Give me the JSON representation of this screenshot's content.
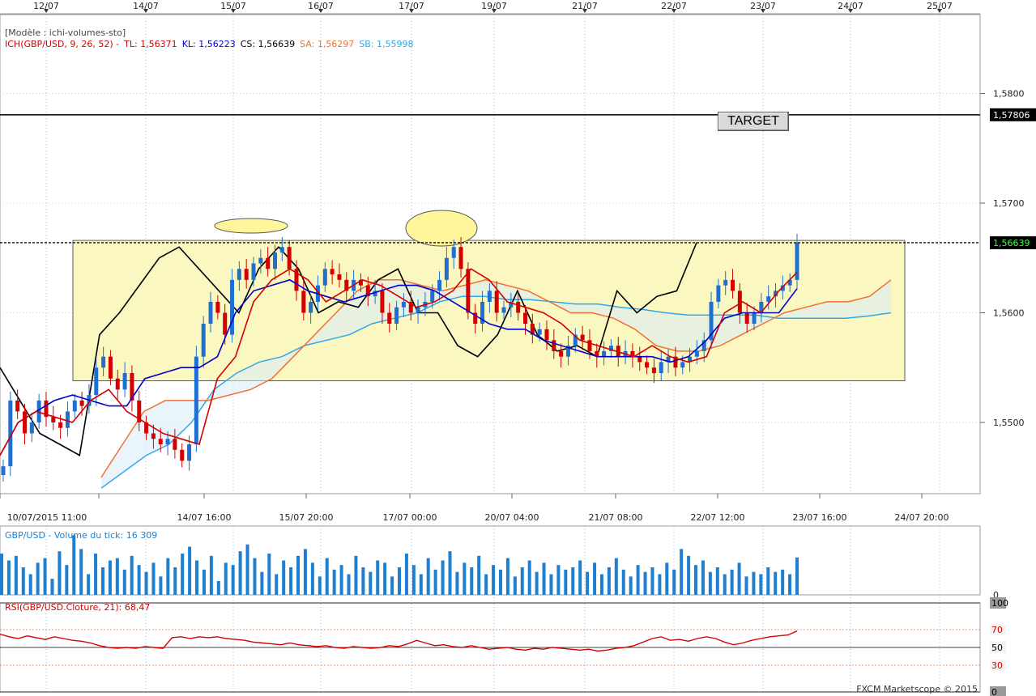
{
  "window": {
    "model_label": "[Modèle : ichi-volumes-sto]",
    "copyright": "FXCM Marketscope © 2015"
  },
  "ichimoku_legend": {
    "prefix": "ICH(GBP/USD, 9, 26, 52) -",
    "tl": "TL: 1,56371",
    "kl": "KL: 1,56223",
    "cs": "CS: 1,56639",
    "sa": "SA: 1,56297",
    "sb": "SB: 1,55998"
  },
  "volume_legend": "GBP/USD - Volume du tick: 16 309",
  "rsi_legend": "RSI(GBP/USD.Cloture, 21): 68,47",
  "annotations": {
    "target_label": "TARGET",
    "target_price": "1,57806",
    "current_price": "1,56639"
  },
  "colors": {
    "tl": "#d40000",
    "kl": "#0000c8",
    "cs": "#000000",
    "sa": "#f07030",
    "sb": "#30a8e8",
    "box_fill": "#fbf7c0",
    "volume": "#1e7fd0",
    "rsi": "#d40000"
  },
  "chart_data": [
    {
      "type": "candlestick",
      "top_date_ticks": [
        "12/07",
        "14/07",
        "15/07",
        "16/07",
        "17/07",
        "19/07",
        "21/07",
        "22/07",
        "23/07",
        "24/07",
        "25/07"
      ],
      "x_ticks": [
        "10/07/2015 11:00",
        "14/07 16:00",
        "15/07 20:00",
        "17/07 00:00",
        "20/07 04:00",
        "21/07 08:00",
        "22/07 12:00",
        "23/07 16:00",
        "24/07 20:00"
      ],
      "y_ticks": [
        "1,5800",
        "1,5700",
        "1,5600",
        "1,5500"
      ],
      "ylim": [
        1.5435,
        1.5872
      ],
      "target_level": 1.57806,
      "current_level": 1.56639,
      "range_box": {
        "low": 1.5538,
        "high": 1.5666
      },
      "closes": [
        1.546,
        1.552,
        1.551,
        1.549,
        1.55,
        1.552,
        1.5505,
        1.55,
        1.5495,
        1.551,
        1.552,
        1.5515,
        1.5525,
        1.555,
        1.556,
        1.554,
        1.553,
        1.5545,
        1.552,
        1.55,
        1.549,
        1.5485,
        1.548,
        1.5485,
        1.5475,
        1.5465,
        1.548,
        1.556,
        1.559,
        1.561,
        1.56,
        1.558,
        1.563,
        1.564,
        1.563,
        1.5645,
        1.565,
        1.564,
        1.5655,
        1.566,
        1.564,
        1.562,
        1.56,
        1.561,
        1.5625,
        1.564,
        1.5635,
        1.563,
        1.562,
        1.563,
        1.5625,
        1.5615,
        1.562,
        1.56,
        1.559,
        1.5605,
        1.561,
        1.56,
        1.5605,
        1.561,
        1.562,
        1.563,
        1.565,
        1.566,
        1.564,
        1.56,
        1.559,
        1.561,
        1.562,
        1.56,
        1.5605,
        1.561,
        1.56,
        1.559,
        1.558,
        1.5585,
        1.5575,
        1.5565,
        1.556,
        1.557,
        1.558,
        1.5575,
        1.5565,
        1.556,
        1.5565,
        1.557,
        1.556,
        1.5565,
        1.556,
        1.5555,
        1.555,
        1.5545,
        1.5555,
        1.556,
        1.555,
        1.5555,
        1.556,
        1.5565,
        1.5575,
        1.561,
        1.5625,
        1.563,
        1.562,
        1.56,
        1.559,
        1.56,
        1.561,
        1.5615,
        1.562,
        1.5625,
        1.563,
        1.5664
      ],
      "tenkan": [
        1.547,
        1.55,
        1.551,
        1.5505,
        1.55,
        1.552,
        1.553,
        1.551,
        1.55,
        1.549,
        1.5485,
        1.548,
        1.554,
        1.556,
        1.561,
        1.563,
        1.564,
        1.563,
        1.561,
        1.562,
        1.563,
        1.5625,
        1.5615,
        1.5605,
        1.561,
        1.562,
        1.564,
        1.563,
        1.561,
        1.5605,
        1.56,
        1.559,
        1.5575,
        1.557,
        1.5565,
        1.556,
        1.557,
        1.556,
        1.5555,
        1.556,
        1.56,
        1.561,
        1.56,
        1.562,
        1.5637
      ],
      "kijun": [
        1.547,
        1.55,
        1.551,
        1.552,
        1.5525,
        1.552,
        1.5515,
        1.5515,
        1.554,
        1.5545,
        1.555,
        1.555,
        1.556,
        1.56,
        1.562,
        1.5625,
        1.563,
        1.562,
        1.5615,
        1.561,
        1.5615,
        1.562,
        1.5625,
        1.5625,
        1.562,
        1.561,
        1.56,
        1.559,
        1.5585,
        1.5585,
        1.5575,
        1.557,
        1.5565,
        1.556,
        1.556,
        1.556,
        1.556,
        1.5555,
        1.556,
        1.5575,
        1.5595,
        1.56,
        1.56,
        1.56,
        1.5622
      ],
      "chikou": [
        1.555,
        1.552,
        1.549,
        1.548,
        1.547,
        1.558,
        1.56,
        1.5625,
        1.565,
        1.566,
        1.564,
        1.562,
        1.56,
        1.564,
        1.566,
        1.564,
        1.56,
        1.561,
        1.5605,
        1.563,
        1.564,
        1.56,
        1.56,
        1.557,
        1.556,
        1.558,
        1.562,
        1.558,
        1.5565,
        1.557,
        1.556,
        1.562,
        1.56,
        1.5615,
        1.562,
        1.5664
      ],
      "senkou_a": [
        1.545,
        1.548,
        1.551,
        1.552,
        1.552,
        1.552,
        1.5525,
        1.553,
        1.554,
        1.556,
        1.558,
        1.56,
        1.562,
        1.563,
        1.563,
        1.5625,
        1.562,
        1.5625,
        1.563,
        1.5625,
        1.562,
        1.561,
        1.56,
        1.56,
        1.5595,
        1.5585,
        1.557,
        1.5565,
        1.5565,
        1.557,
        1.558,
        1.559,
        1.56,
        1.5605,
        1.561,
        1.561,
        1.5615,
        1.563
      ],
      "senkou_b": [
        1.544,
        1.5455,
        1.547,
        1.548,
        1.55,
        1.553,
        1.5545,
        1.5555,
        1.556,
        1.557,
        1.5575,
        1.558,
        1.559,
        1.5595,
        1.56,
        1.561,
        1.5615,
        1.5615,
        1.5612,
        1.5612,
        1.561,
        1.5608,
        1.5608,
        1.5605,
        1.5603,
        1.56,
        1.5598,
        1.5598,
        1.5598,
        1.5598,
        1.5595,
        1.5595,
        1.5595,
        1.5595,
        1.5597,
        1.56
      ],
      "volume_ylim": [
        0,
        30000
      ],
      "volume_y_ticks": [
        "0"
      ],
      "volumes": [
        18000,
        15000,
        17000,
        12000,
        9000,
        14000,
        16000,
        7000,
        19000,
        13000,
        26000,
        20000,
        9000,
        18000,
        12000,
        15000,
        16000,
        11000,
        17000,
        13000,
        10000,
        14000,
        8000,
        16000,
        12000,
        18000,
        21000,
        15000,
        11000,
        17000,
        6000,
        14000,
        13000,
        19000,
        22000,
        16000,
        10000,
        18000,
        9000,
        15000,
        12000,
        17000,
        20000,
        14000,
        8000,
        16000,
        11000,
        13000,
        9000,
        17000,
        12000,
        10000,
        15000,
        14000,
        8000,
        12000,
        18000,
        13000,
        9000,
        16000,
        11000,
        15000,
        19000,
        10000,
        14000,
        12000,
        17000,
        9000,
        13000,
        11000,
        16000,
        8000,
        12000,
        15000,
        10000,
        14000,
        9000,
        13000,
        11000,
        12000,
        15000,
        10000,
        14000,
        9000,
        12000,
        16000,
        11000,
        8000,
        13000,
        10000,
        12000,
        9000,
        14000,
        11000,
        20000,
        17000,
        13000,
        15000,
        10000,
        12000,
        9000,
        11000,
        14000,
        8000,
        10000,
        9000,
        12000,
        10000,
        11000,
        9000,
        16309
      ],
      "rsi_ylim": [
        0,
        100
      ],
      "rsi_y_ticks": [
        "100",
        "70",
        "50",
        "30",
        "0"
      ],
      "rsi": [
        65,
        62,
        60,
        63,
        61,
        59,
        62,
        60,
        58,
        57,
        55,
        52,
        50,
        49,
        50,
        49,
        51,
        50,
        49,
        61,
        62,
        60,
        62,
        61,
        62,
        60,
        59,
        58,
        56,
        55,
        54,
        53,
        55,
        53,
        52,
        51,
        52,
        50,
        49,
        51,
        50,
        49,
        50,
        52,
        51,
        54,
        58,
        55,
        52,
        53,
        51,
        50,
        52,
        50,
        48,
        49,
        50,
        48,
        47,
        49,
        48,
        50,
        49,
        48,
        47,
        48,
        46,
        47,
        49,
        50,
        52,
        56,
        60,
        62,
        58,
        59,
        57,
        60,
        62,
        60,
        56,
        53,
        55,
        58,
        60,
        62,
        63,
        64,
        68.47
      ]
    }
  ]
}
